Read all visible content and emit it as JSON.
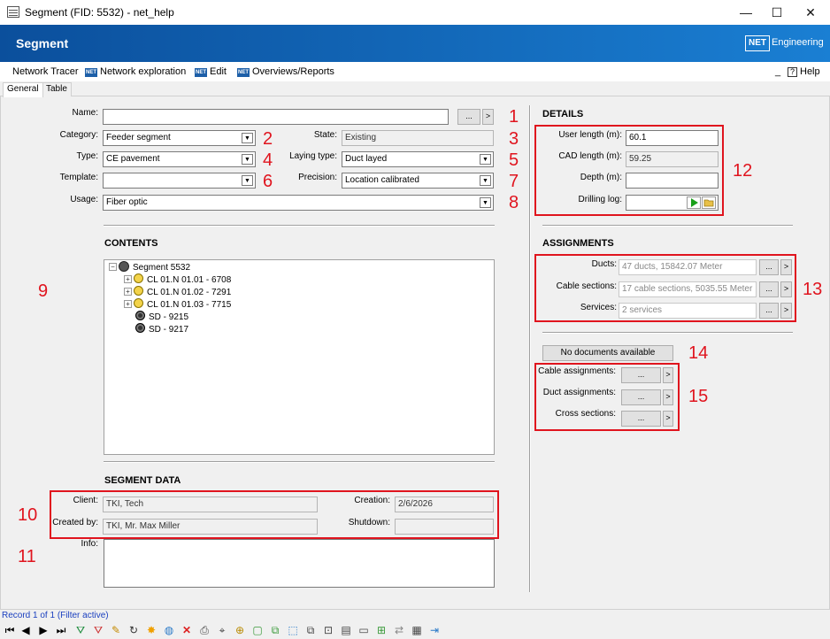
{
  "window": {
    "title": "Segment (FID: 5532) - net_help",
    "minimize": "—",
    "maximize": "☐",
    "close": "✕"
  },
  "header": {
    "title": "Segment",
    "logo_text": "NET",
    "brand": "Engineering"
  },
  "menu": {
    "items": [
      "Network Tracer",
      "Network exploration",
      "Edit",
      "Overviews/Reports"
    ],
    "badge": "NET",
    "dash": "_",
    "help": "Help",
    "help_icon": "?"
  },
  "tabs": [
    "General",
    "Table"
  ],
  "form": {
    "name_label": "Name:",
    "name_value": "",
    "name_btn": "...",
    "name_nav": ">",
    "category_label": "Category:",
    "category_value": "Feeder segment",
    "type_label": "Type:",
    "type_value": "CE pavement",
    "template_label": "Template:",
    "template_value": "",
    "usage_label": "Usage:",
    "usage_value": "Fiber optic",
    "state_label": "State:",
    "state_value": "Existing",
    "laying_label": "Laying type:",
    "laying_value": "Duct layed",
    "precision_label": "Precision:",
    "precision_value": "Location calibrated"
  },
  "contents": {
    "title": "CONTENTS",
    "tree": [
      {
        "text": "Segment 5532",
        "icon": "segment-icon"
      },
      {
        "text": "CL 01.N 01.01 - 6708",
        "icon": "cable-icon"
      },
      {
        "text": "CL 01.N 01.02 - 7291",
        "icon": "cable-icon"
      },
      {
        "text": "CL 01.N 01.03 - 7715",
        "icon": "cable-icon"
      },
      {
        "text": "SD - 9215",
        "icon": "splice-icon"
      },
      {
        "text": "SD - 9217",
        "icon": "splice-icon"
      }
    ]
  },
  "segment_data": {
    "title": "SEGMENT DATA",
    "client_label": "Client:",
    "client_value": "TKI, Tech",
    "created_by_label": "Created by:",
    "created_by_value": "TKI, Mr. Max Miller",
    "creation_label": "Creation:",
    "creation_value": "2/6/2026",
    "shutdown_label": "Shutdown:",
    "shutdown_value": "",
    "info_label": "Info:"
  },
  "details": {
    "title": "DETAILS",
    "user_length_label": "User length (m):",
    "user_length_value": "60.1",
    "cad_length_label": "CAD length (m):",
    "cad_length_value": "59.25",
    "depth_label": "Depth (m):",
    "depth_value": "",
    "drilling_label": "Drilling log:"
  },
  "assignments": {
    "title": "ASSIGNMENTS",
    "ducts_label": "Ducts:",
    "ducts_value": "47 ducts, 15842.07 Meter",
    "cable_sections_label": "Cable sections:",
    "cable_sections_value": "17 cable sections, 5035.55 Meter",
    "services_label": "Services:",
    "services_value": "2 services",
    "btn": "...",
    "nav": ">"
  },
  "documents": {
    "no_docs": "No documents available",
    "cable_assignments_label": "Cable assignments:",
    "duct_assignments_label": "Duct assignments:",
    "cross_sections_label": "Cross sections:"
  },
  "callouts": [
    "1",
    "2",
    "3",
    "4",
    "5",
    "6",
    "7",
    "8",
    "9",
    "10",
    "11",
    "12",
    "13",
    "14",
    "15"
  ],
  "status": {
    "record": "Record 1 of 1 (Filter active)"
  },
  "colors": {
    "accent": "#0b4f9c",
    "callout": "#e0141e"
  }
}
